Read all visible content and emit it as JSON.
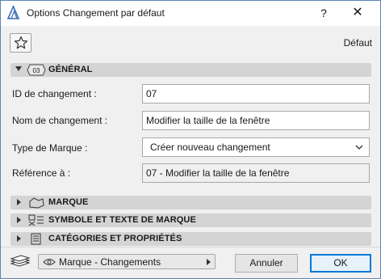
{
  "window": {
    "title": "Options Changement par défaut",
    "help_label": "?",
    "close_label": "✕"
  },
  "toolbar": {
    "favorite_icon": "star-icon",
    "default_label": "Défaut"
  },
  "sections": {
    "general": {
      "label": "GÉNÉRAL",
      "icon_text": "03",
      "expanded": true
    },
    "marque": {
      "label": "MARQUE",
      "expanded": false
    },
    "symbole": {
      "label": "SYMBOLE ET TEXTE DE MARQUE",
      "expanded": false
    },
    "categories": {
      "label": "CATÉGORIES ET PROPRIÉTÉS",
      "expanded": false
    }
  },
  "fields": {
    "id": {
      "label": "ID de changement :",
      "value": "07"
    },
    "name": {
      "label": "Nom de changement :",
      "value": "Modifier la taille de la fenêtre"
    },
    "type": {
      "label": "Type de Marque :",
      "value": "Créer nouveau changement"
    },
    "reference": {
      "label": "Référence à :",
      "value": "07 - Modifier la taille de la fenêtre"
    }
  },
  "footer": {
    "layer_dropdown": "Marque - Changements",
    "cancel_label": "Annuler",
    "ok_label": "OK"
  },
  "colors": {
    "accent": "#0078d7",
    "window_border": "#5a84b8",
    "section_bg": "#d4d4d4"
  }
}
